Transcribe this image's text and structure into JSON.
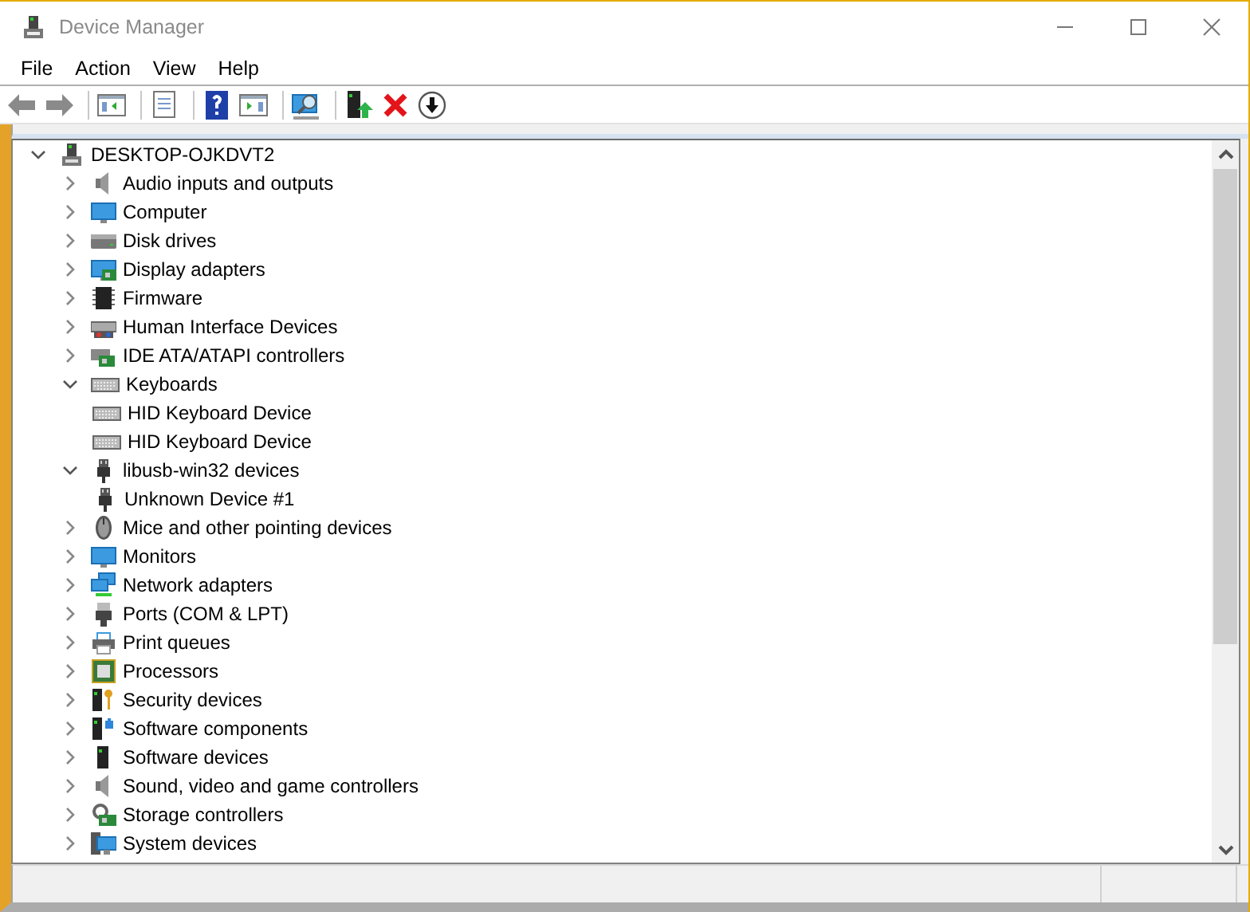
{
  "window": {
    "title": "Device Manager"
  },
  "menu": [
    "File",
    "Action",
    "View",
    "Help"
  ],
  "toolbar": [
    {
      "kind": "back",
      "disabled": false
    },
    {
      "kind": "forward",
      "disabled": false
    },
    {
      "kind": "sep"
    },
    {
      "kind": "console-tree"
    },
    {
      "kind": "sep"
    },
    {
      "kind": "properties"
    },
    {
      "kind": "sep"
    },
    {
      "kind": "help"
    },
    {
      "kind": "action-pane"
    },
    {
      "kind": "sep"
    },
    {
      "kind": "scan"
    },
    {
      "kind": "sep"
    },
    {
      "kind": "update"
    },
    {
      "kind": "uninstall"
    },
    {
      "kind": "disable"
    }
  ],
  "tree": {
    "label": "DESKTOP-OJKDVT2",
    "kind": "pc",
    "expanded": true,
    "children": [
      {
        "label": "Audio inputs and outputs",
        "kind": "speaker",
        "expanded": false
      },
      {
        "label": "Computer",
        "kind": "monitor",
        "expanded": false
      },
      {
        "label": "Disk drives",
        "kind": "drive",
        "expanded": false
      },
      {
        "label": "Display adapters",
        "kind": "display",
        "expanded": false
      },
      {
        "label": "Firmware",
        "kind": "chip",
        "expanded": false
      },
      {
        "label": "Human Interface Devices",
        "kind": "hid",
        "expanded": false
      },
      {
        "label": "IDE ATA/ATAPI controllers",
        "kind": "card",
        "expanded": false
      },
      {
        "label": "Keyboards",
        "kind": "keyboard",
        "expanded": true,
        "children": [
          {
            "label": "HID Keyboard Device",
            "kind": "keyboard"
          },
          {
            "label": "HID Keyboard Device",
            "kind": "keyboard"
          }
        ]
      },
      {
        "label": "libusb-win32 devices",
        "kind": "usb",
        "expanded": true,
        "children": [
          {
            "label": "Unknown Device #1",
            "kind": "usb"
          }
        ]
      },
      {
        "label": "Mice and other pointing devices",
        "kind": "mouse",
        "expanded": false
      },
      {
        "label": "Monitors",
        "kind": "monitor",
        "expanded": false
      },
      {
        "label": "Network adapters",
        "kind": "network",
        "expanded": false
      },
      {
        "label": "Ports (COM & LPT)",
        "kind": "port",
        "expanded": false
      },
      {
        "label": "Print queues",
        "kind": "printer",
        "expanded": false
      },
      {
        "label": "Processors",
        "kind": "processor",
        "expanded": false
      },
      {
        "label": "Security devices",
        "kind": "security",
        "expanded": false
      },
      {
        "label": "Software components",
        "kind": "component",
        "expanded": false
      },
      {
        "label": "Software devices",
        "kind": "tower",
        "expanded": false
      },
      {
        "label": "Sound, video and game controllers",
        "kind": "speaker",
        "expanded": false
      },
      {
        "label": "Storage controllers",
        "kind": "storage",
        "expanded": false
      },
      {
        "label": "System devices",
        "kind": "system",
        "expanded": false
      }
    ]
  }
}
